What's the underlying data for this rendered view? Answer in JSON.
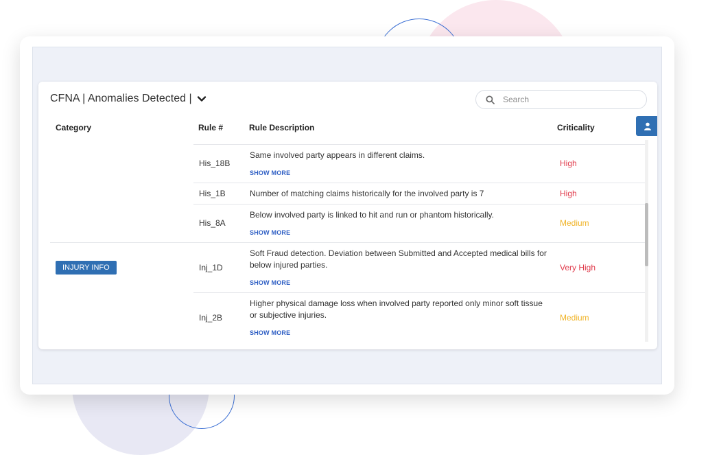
{
  "header": {
    "title": "CFNA | Anomalies Detected |",
    "search_placeholder": "Search"
  },
  "table": {
    "columns": {
      "category": "Category",
      "rule": "Rule #",
      "description": "Rule Description",
      "criticality": "Criticality"
    },
    "category_badge": "INJURY INFO",
    "show_more_label": "SHOW MORE",
    "rows": [
      {
        "rule": "His_18B",
        "description": "Same involved party appears in different claims.",
        "criticality": "High"
      },
      {
        "rule": "His_1B",
        "description": "Number of matching claims historically for the involved party is 7",
        "criticality": "High"
      },
      {
        "rule": "His_8A",
        "description": "Below involved party is linked to hit and run or phantom historically.",
        "criticality": "Medium"
      },
      {
        "rule": "Inj_1D",
        "description": "Soft Fraud detection. Deviation between Submitted and Accepted medical bills for below injured parties.",
        "criticality": "Very High"
      },
      {
        "rule": "Inj_2B",
        "description": "Higher physical damage loss when involved party reported only minor soft tissue or subjective injuries.",
        "criticality": "Medium"
      }
    ]
  },
  "colors": {
    "high": "#e0394a",
    "medium": "#f0b429",
    "accent": "#2f6fb3"
  },
  "icons": {
    "dropdown": "chevron-down-icon",
    "search": "search-icon",
    "user": "user-icon"
  }
}
